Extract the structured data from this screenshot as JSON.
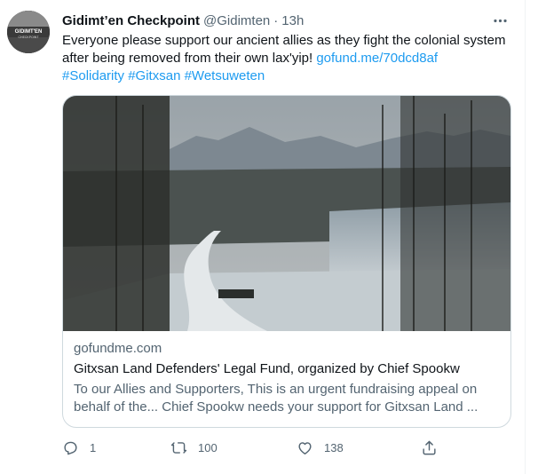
{
  "tweet": {
    "author": {
      "display_name": "Gidimt’en Checkpoint",
      "handle": "@Gidimten",
      "dot": "·",
      "time": "13h",
      "avatar_text": "GIDIMT'EN",
      "avatar_subtext": "CHECKPOINT"
    },
    "text_line1": "Everyone please support our ancient allies as they fight the colonial system",
    "text_line2": "after being removed from their own lax'yip! ",
    "link": "gofund.me/70dcd8af",
    "hashtags": [
      "#Solidarity",
      "#Gitxsan",
      "#Wetsuweten"
    ],
    "card": {
      "domain": "gofundme.com",
      "title": "Gitxsan Land Defenders' Legal Fund, organized by Chief Spookw",
      "description_line1": "To our Allies and Supporters, This is an urgent fundraising appeal on",
      "description_line2": "behalf of the... Chief Spookw needs your support for Gitxsan Land ..."
    },
    "actions": {
      "replies": "1",
      "retweets": "100",
      "likes": "138"
    },
    "colors": {
      "link": "#1d9bf0",
      "secondary_text": "#536471",
      "border": "#cfd9de"
    },
    "icons": [
      "more-icon",
      "reply-icon",
      "retweet-icon",
      "like-icon",
      "share-icon"
    ]
  }
}
